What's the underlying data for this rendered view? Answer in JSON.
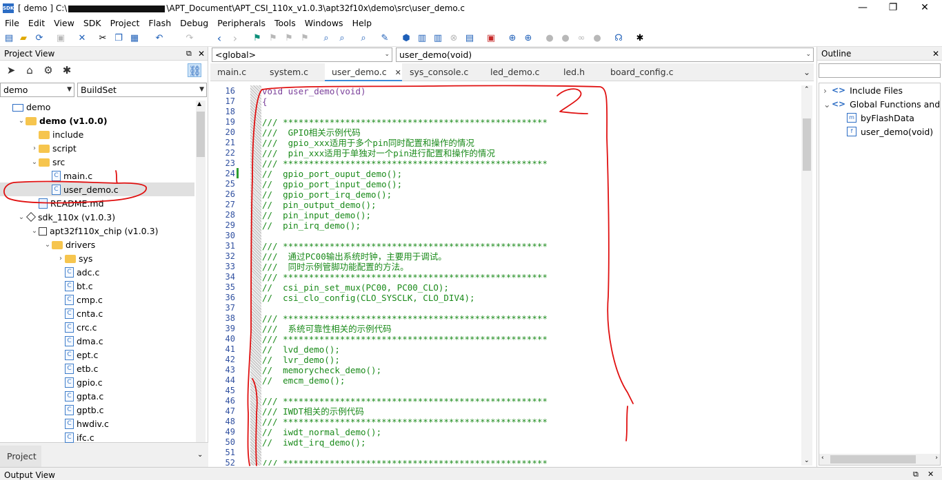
{
  "window": {
    "title_prefix": "[ demo ] C:\\",
    "title_suffix": "\\APT_Document\\APT_CSI_110x_v1.0.3\\apt32f10x\\demo\\src\\user_demo.c",
    "app_icon_text": "SDK",
    "minimize": "—",
    "maximize": "❐",
    "close": "✕"
  },
  "menu": [
    "File",
    "Edit",
    "View",
    "SDK",
    "Project",
    "Flash",
    "Debug",
    "Peripherals",
    "Tools",
    "Windows",
    "Help"
  ],
  "project_view": {
    "header": "Project View",
    "combo_project": "demo",
    "combo_build": "BuildSet",
    "bottom_tab": "Project",
    "tree": [
      {
        "label": "demo",
        "indent": 0,
        "icon": "project",
        "twisty": ""
      },
      {
        "label": "demo (v1.0.0)",
        "indent": 1,
        "icon": "folder",
        "twisty": "expanded",
        "bold": true
      },
      {
        "label": "include",
        "indent": 2,
        "icon": "folder",
        "twisty": ""
      },
      {
        "label": "script",
        "indent": 2,
        "icon": "folder",
        "twisty": "collapsed"
      },
      {
        "label": "src",
        "indent": 2,
        "icon": "folder",
        "twisty": "expanded"
      },
      {
        "label": "main.c",
        "indent": 3,
        "icon": "c",
        "twisty": ""
      },
      {
        "label": "user_demo.c",
        "indent": 3,
        "icon": "c",
        "twisty": "",
        "selected": true
      },
      {
        "label": "README.md",
        "indent": 2,
        "icon": "md",
        "twisty": ""
      },
      {
        "label": "sdk_110x (v1.0.3)",
        "indent": 1,
        "icon": "diamond",
        "twisty": "expanded"
      },
      {
        "label": "apt32f110x_chip (v1.0.3)",
        "indent": 2,
        "icon": "chip",
        "twisty": "expanded"
      },
      {
        "label": "drivers",
        "indent": 3,
        "icon": "folder",
        "twisty": "expanded"
      },
      {
        "label": "sys",
        "indent": 4,
        "icon": "folder",
        "twisty": "collapsed"
      },
      {
        "label": "adc.c",
        "indent": 4,
        "icon": "c",
        "twisty": ""
      },
      {
        "label": "bt.c",
        "indent": 4,
        "icon": "c",
        "twisty": ""
      },
      {
        "label": "cmp.c",
        "indent": 4,
        "icon": "c",
        "twisty": ""
      },
      {
        "label": "cnta.c",
        "indent": 4,
        "icon": "c",
        "twisty": ""
      },
      {
        "label": "crc.c",
        "indent": 4,
        "icon": "c",
        "twisty": ""
      },
      {
        "label": "dma.c",
        "indent": 4,
        "icon": "c",
        "twisty": ""
      },
      {
        "label": "ept.c",
        "indent": 4,
        "icon": "c",
        "twisty": ""
      },
      {
        "label": "etb.c",
        "indent": 4,
        "icon": "c",
        "twisty": ""
      },
      {
        "label": "gpio.c",
        "indent": 4,
        "icon": "c",
        "twisty": ""
      },
      {
        "label": "gpta.c",
        "indent": 4,
        "icon": "c",
        "twisty": ""
      },
      {
        "label": "gptb.c",
        "indent": 4,
        "icon": "c",
        "twisty": ""
      },
      {
        "label": "hwdiv.c",
        "indent": 4,
        "icon": "c",
        "twisty": ""
      },
      {
        "label": "ifc.c",
        "indent": 4,
        "icon": "c",
        "twisty": ""
      }
    ]
  },
  "editor": {
    "scope_combo": "<global>",
    "func_combo": "user_demo(void)",
    "tabs": [
      "main.c",
      "system.c",
      "user_demo.c",
      "sys_console.c",
      "led_demo.c",
      "led.h",
      "board_config.c"
    ],
    "active_tab": 2,
    "tab_close": "✕",
    "lines": [
      {
        "n": "16",
        "t": "void user_demo(void)",
        "kw": true
      },
      {
        "n": "17",
        "t": "{",
        "kw": true
      },
      {
        "n": "18",
        "t": ""
      },
      {
        "n": "19",
        "t": "/// ***************************************************"
      },
      {
        "n": "20",
        "t": "///  GPIO相关示例代码"
      },
      {
        "n": "21",
        "t": "///  gpio_xxx适用于多个pin同时配置和操作的情况"
      },
      {
        "n": "22",
        "t": "///  pin_xxx适用于单独对一个pin进行配置和操作的情况"
      },
      {
        "n": "23",
        "t": "/// ***************************************************"
      },
      {
        "n": "24",
        "t": "//  gpio_port_ouput_demo();"
      },
      {
        "n": "25",
        "t": "//  gpio_port_input_demo();"
      },
      {
        "n": "26",
        "t": "//  gpio_port_irq_demo();"
      },
      {
        "n": "27",
        "t": "//  pin_output_demo();"
      },
      {
        "n": "28",
        "t": "//  pin_input_demo();"
      },
      {
        "n": "29",
        "t": "//  pin_irq_demo();"
      },
      {
        "n": "30",
        "t": ""
      },
      {
        "n": "31",
        "t": "/// ***************************************************"
      },
      {
        "n": "32",
        "t": "///  通过PC00输出系统时钟，主要用于调试。"
      },
      {
        "n": "33",
        "t": "///  同时示例管脚功能配置的方法。"
      },
      {
        "n": "34",
        "t": "/// ***************************************************"
      },
      {
        "n": "35",
        "t": "//  csi_pin_set_mux(PC00, PC00_CLO);"
      },
      {
        "n": "36",
        "t": "//  csi_clo_config(CLO_SYSCLK, CLO_DIV4);"
      },
      {
        "n": "37",
        "t": ""
      },
      {
        "n": "38",
        "t": "/// ***************************************************"
      },
      {
        "n": "39",
        "t": "///  系统可靠性相关的示例代码"
      },
      {
        "n": "40",
        "t": "/// ***************************************************"
      },
      {
        "n": "41",
        "t": "//  lvd_demo();"
      },
      {
        "n": "42",
        "t": "//  lvr_demo();"
      },
      {
        "n": "43",
        "t": "//  memorycheck_demo();"
      },
      {
        "n": "44",
        "t": "//  emcm_demo();"
      },
      {
        "n": "45",
        "t": ""
      },
      {
        "n": "46",
        "t": "/// ***************************************************"
      },
      {
        "n": "47",
        "t": "/// IWDT相关的示例代码"
      },
      {
        "n": "48",
        "t": "/// ***************************************************"
      },
      {
        "n": "49",
        "t": "//  iwdt_normal_demo();"
      },
      {
        "n": "50",
        "t": "//  iwdt_irq_demo();"
      },
      {
        "n": "51",
        "t": ""
      },
      {
        "n": "52",
        "t": "/// ***************************************************"
      }
    ]
  },
  "outline": {
    "header": "Outline",
    "items": [
      {
        "label": "Include Files",
        "indent": 0,
        "twisty": "›"
      },
      {
        "label": "Global Functions and V",
        "indent": 0,
        "twisty": "⌄"
      },
      {
        "label": "byFlashData",
        "indent": 1,
        "icon": "m"
      },
      {
        "label": "user_demo(void)",
        "indent": 1,
        "icon": "f"
      }
    ]
  },
  "output_view": {
    "header": "Output View"
  },
  "colors": {
    "comment_green": "#1a8a1a",
    "keyword_purple": "#7a3f9a",
    "line_number_blue": "#3050a0",
    "annotation_red": "#e01010",
    "active_tab_blue": "#3b8ad8"
  },
  "annotation_label": "2"
}
